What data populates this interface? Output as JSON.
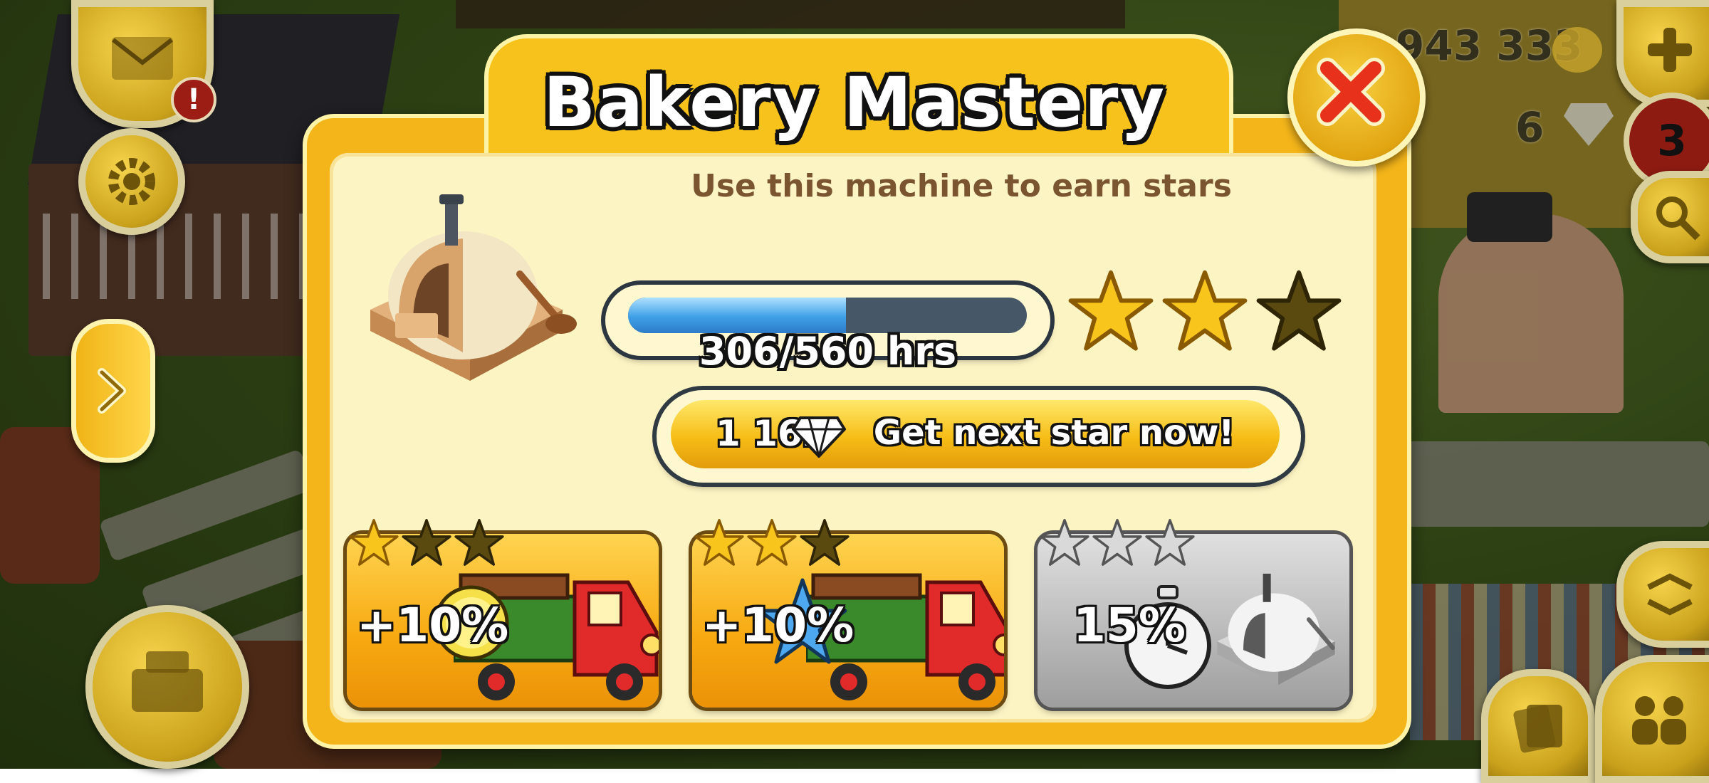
{
  "hud": {
    "coins": "943 333",
    "diamonds": "6",
    "notification_count": "3",
    "mail_alert": "!"
  },
  "dialog": {
    "title": "Bakery Mastery",
    "subtitle": "Use this machine to earn stars",
    "progress": {
      "current": 306,
      "max": 560,
      "label": "306/560 hrs",
      "fraction": 0.546
    },
    "stars": {
      "earned": 2,
      "total": 3
    },
    "buy_button": {
      "cost": "1 162",
      "label": "Get next star now!"
    },
    "rewards": [
      {
        "label": "+10%",
        "reward_icon": "coin-icon",
        "item_icon": "truck-icon",
        "stars": 1,
        "unlocked": true
      },
      {
        "label": "+10%",
        "reward_icon": "star-icon",
        "item_icon": "truck-icon",
        "stars": 2,
        "unlocked": true
      },
      {
        "label": "15%",
        "reward_icon": "stopwatch-icon",
        "item_icon": "bakery-oven-icon",
        "stars": 3,
        "unlocked": false
      }
    ]
  },
  "colors": {
    "panel": "#f4b51a",
    "panel_inner": "#fdf4c3",
    "progress_fill": "#3e9fe6",
    "star_gold": "#f7c51b",
    "star_empty": "#5b4a10",
    "close_x": "#e8311a"
  }
}
